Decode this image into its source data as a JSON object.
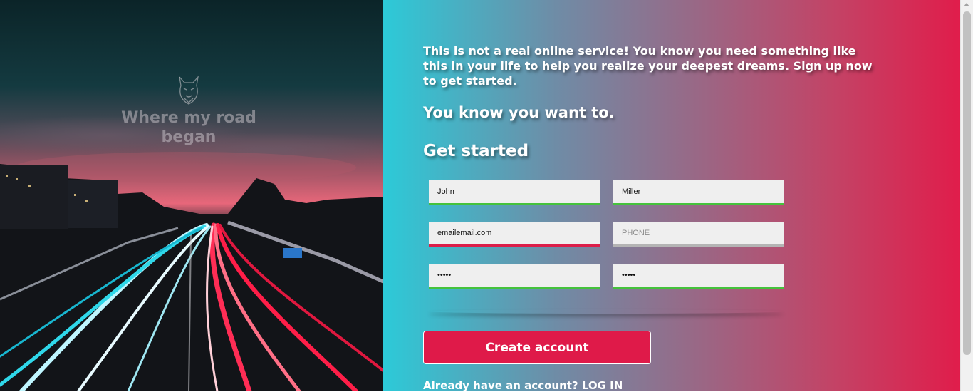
{
  "hero": {
    "logo_text": "Where my road began",
    "logo_icon": "bulldog-head-icon"
  },
  "intro": {
    "text": "This is not a real online service! You know you need something like this in your life to help you realize your deepest dreams. Sign up now to get started.",
    "tagline": "You know you want to.",
    "heading": "Get started"
  },
  "form": {
    "first_name": {
      "value": "John",
      "placeholder": "",
      "state": "valid"
    },
    "last_name": {
      "value": "Miller",
      "placeholder": "",
      "state": "valid"
    },
    "email": {
      "value": "emailemail.com",
      "placeholder": "",
      "state": "invalid"
    },
    "phone": {
      "value": "",
      "placeholder": "PHONE",
      "state": "empty"
    },
    "password": {
      "value": "•••••",
      "placeholder": "",
      "state": "valid"
    },
    "confirm_password": {
      "value": "•••••",
      "placeholder": "",
      "state": "valid"
    },
    "submit_label": "Create account",
    "login_prompt": "Already have an account?",
    "login_link": "LOG IN"
  },
  "colors": {
    "gradient_start": "#2ccad8",
    "gradient_end": "#e01d4b",
    "accent": "#df1a49",
    "valid": "#45c23c",
    "invalid": "#dc1e49"
  }
}
